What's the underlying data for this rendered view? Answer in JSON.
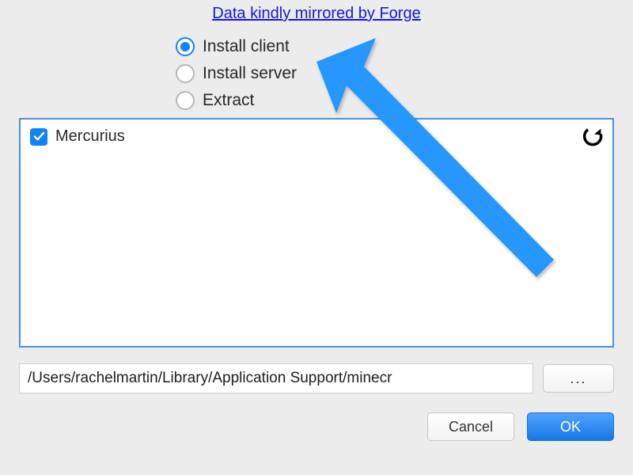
{
  "header": {
    "link_text": "Data kindly mirrored by Forge"
  },
  "radios": {
    "options": [
      {
        "label": "Install client",
        "selected": true
      },
      {
        "label": "Install server",
        "selected": false
      },
      {
        "label": "Extract",
        "selected": false
      }
    ]
  },
  "list": {
    "items": [
      {
        "label": "Mercurius",
        "checked": true
      }
    ]
  },
  "path": {
    "value": "/Users/rachelmartin/Library/Application Support/minecr",
    "browse_label": "..."
  },
  "buttons": {
    "cancel": "Cancel",
    "ok": "OK"
  },
  "colors": {
    "accent": "#1183f7",
    "arrow": "#2897ff"
  }
}
